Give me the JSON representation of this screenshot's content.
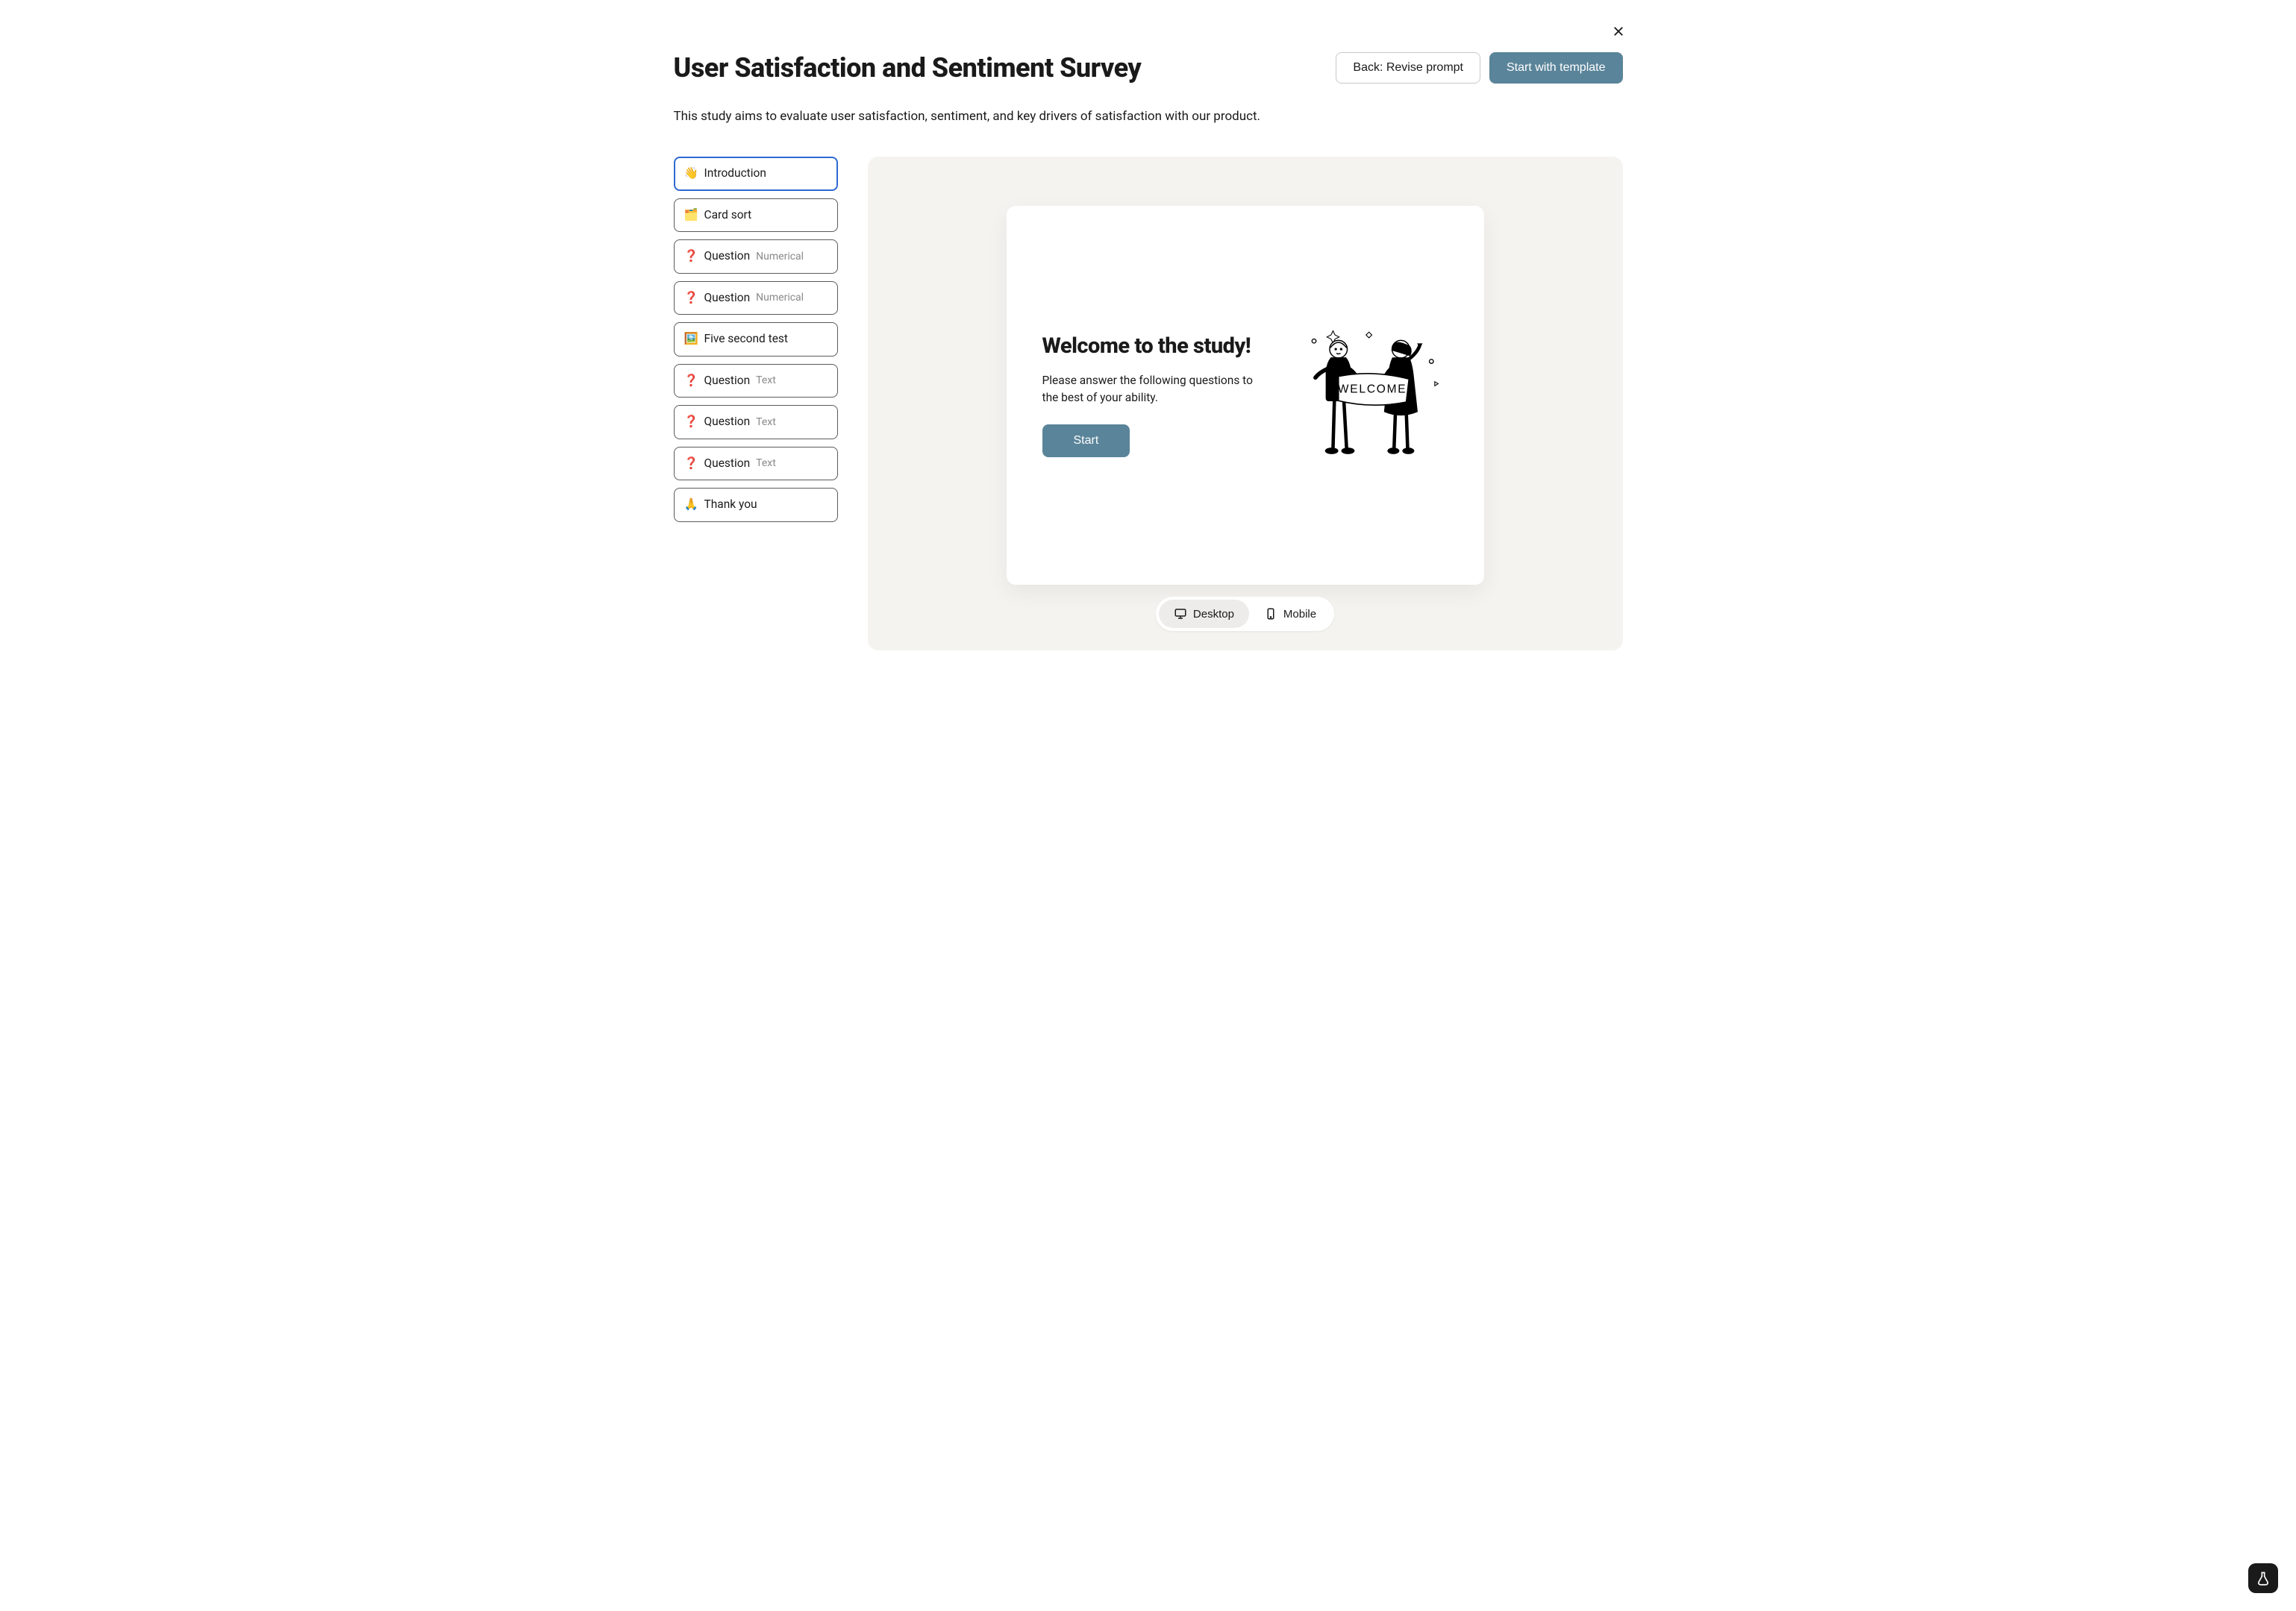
{
  "header": {
    "title": "User Satisfaction and Sentiment Survey",
    "back_label": "Back: Revise prompt",
    "start_label": "Start with template"
  },
  "subtitle": "This study aims to evaluate user satisfaction, sentiment, and key drivers of satisfaction with our product.",
  "sidebar": {
    "items": [
      {
        "icon": "👋",
        "label": "Introduction",
        "sub": "",
        "active": true
      },
      {
        "icon": "🗂️",
        "label": "Card sort",
        "sub": "",
        "active": false
      },
      {
        "icon": "❓",
        "label": "Question",
        "sub": "Numerical",
        "active": false
      },
      {
        "icon": "❓",
        "label": "Question",
        "sub": "Numerical",
        "active": false
      },
      {
        "icon": "🖼️",
        "label": "Five second test",
        "sub": "",
        "active": false
      },
      {
        "icon": "❓",
        "label": "Question",
        "sub": "Text",
        "active": false
      },
      {
        "icon": "❓",
        "label": "Question",
        "sub": "Text",
        "active": false
      },
      {
        "icon": "❓",
        "label": "Question",
        "sub": "Text",
        "active": false
      },
      {
        "icon": "🙏",
        "label": "Thank you",
        "sub": "",
        "active": false
      }
    ]
  },
  "preview": {
    "welcome_title": "Welcome to the study!",
    "welcome_body": "Please answer the following questions to the best of your ability.",
    "start_label": "Start",
    "illustration_banner": "WELCOME"
  },
  "device_toggle": {
    "desktop": "Desktop",
    "mobile": "Mobile",
    "active": "desktop"
  }
}
